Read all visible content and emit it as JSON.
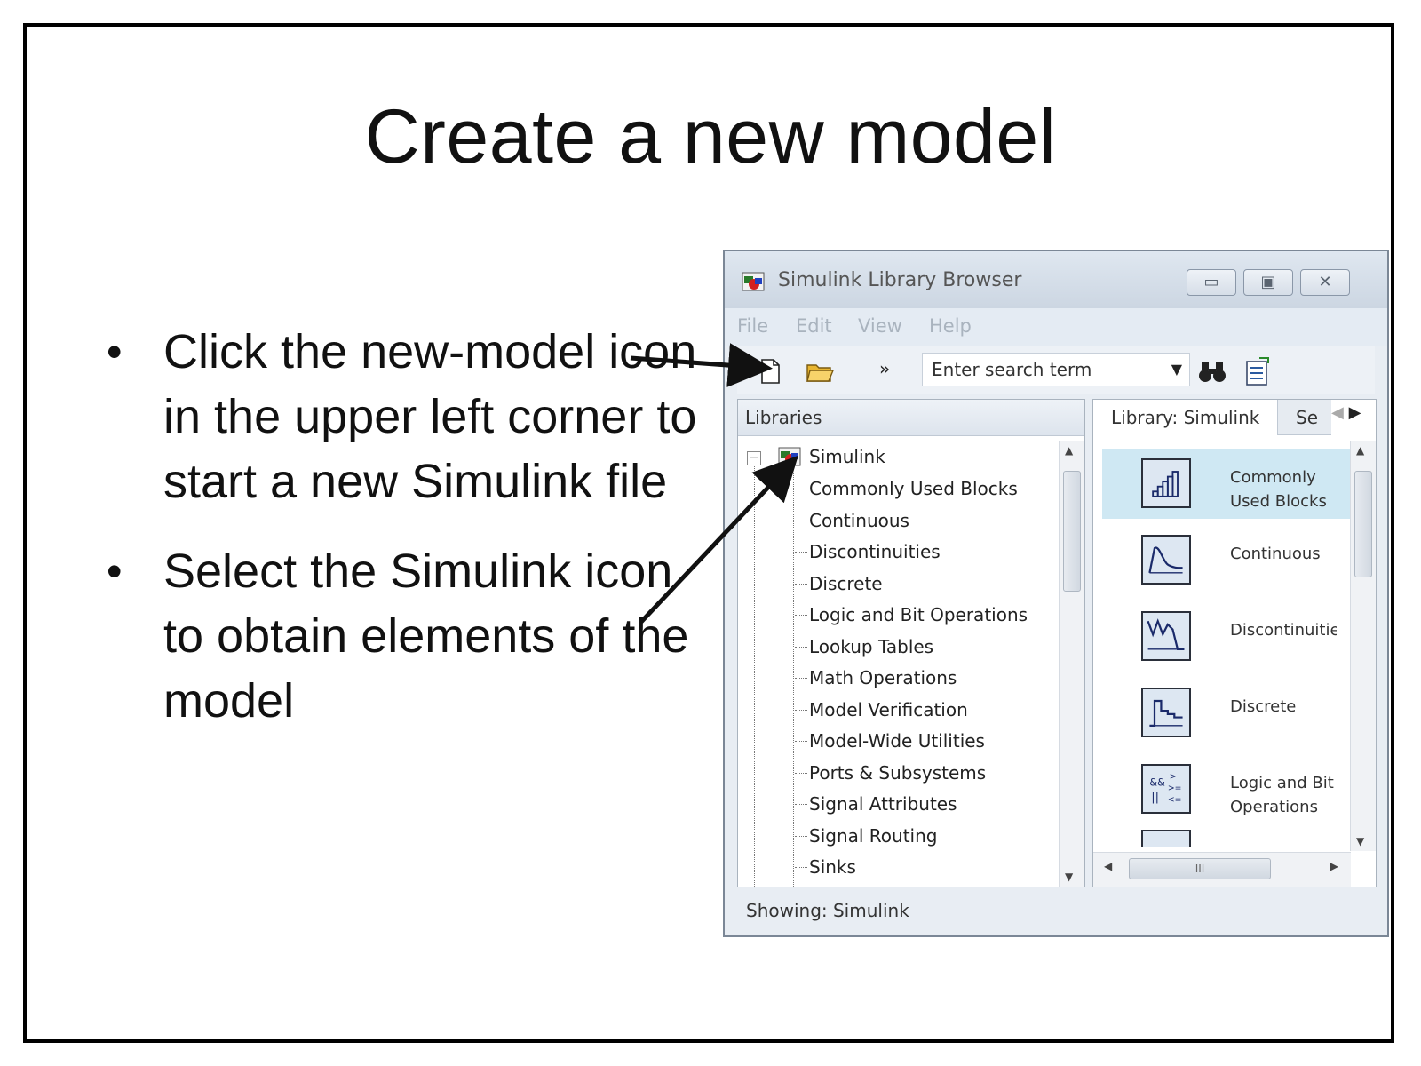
{
  "slide": {
    "title": "Create a new model",
    "bullets": [
      "Click the new-model icon in the upper left corner to start a new Simulink file",
      "Select the Simulink icon to obtain elements of the model"
    ]
  },
  "window": {
    "title": "Simulink Library Browser",
    "buttons": {
      "minimize": "▭",
      "maximize": "▣",
      "close": "✕"
    },
    "menu": [
      "File",
      "Edit",
      "View",
      "Help"
    ],
    "toolbar": {
      "overflow": "»",
      "search_value": "Enter search term"
    },
    "left_pane": {
      "header": "Libraries",
      "root": "Simulink",
      "items": [
        "Commonly Used Blocks",
        "Continuous",
        "Discontinuities",
        "Discrete",
        "Logic and Bit Operations",
        "Lookup Tables",
        "Math Operations",
        "Model Verification",
        "Model-Wide Utilities",
        "Ports & Subsystems",
        "Signal Attributes",
        "Signal Routing",
        "Sinks"
      ]
    },
    "right_pane": {
      "active_tab": "Library: Simulink",
      "inactive_tab": "Se",
      "items": [
        {
          "label": "Commonly Used Blocks",
          "icon": "commonly-used-blocks-icon"
        },
        {
          "label": "Continuous",
          "icon": "continuous-icon"
        },
        {
          "label": "Discontinuities",
          "icon": "discontinuities-icon"
        },
        {
          "label": "Discrete",
          "icon": "discrete-icon"
        },
        {
          "label": "Logic and Bit Operations",
          "icon": "logic-icon"
        }
      ],
      "hscroll_grip": "III"
    },
    "status": "Showing: Simulink"
  }
}
